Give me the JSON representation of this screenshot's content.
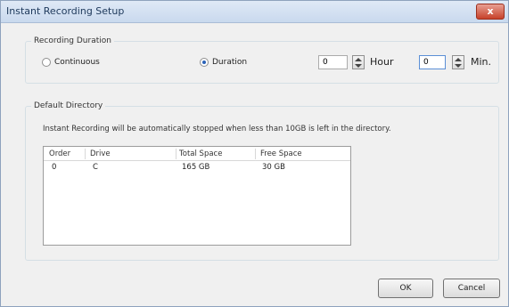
{
  "window": {
    "title": "Instant Recording Setup",
    "close_label": "x"
  },
  "recording": {
    "section_label": "Recording Duration",
    "continuous_label": "Continuous",
    "duration_label": "Duration",
    "selected": "Duration",
    "hour_value": "0",
    "hour_unit": "Hour",
    "min_value": "0",
    "min_unit": "Min."
  },
  "directory": {
    "section_label": "Default Directory",
    "note": "Instant Recording will be automatically stopped when less than 10GB is left in the directory.",
    "columns": [
      "Order",
      "Drive",
      "Total Space",
      "Free Space"
    ],
    "rows": [
      [
        "0",
        "C",
        "165 GB",
        "30 GB"
      ]
    ]
  },
  "buttons": {
    "ok": "OK",
    "cancel": "Cancel"
  }
}
